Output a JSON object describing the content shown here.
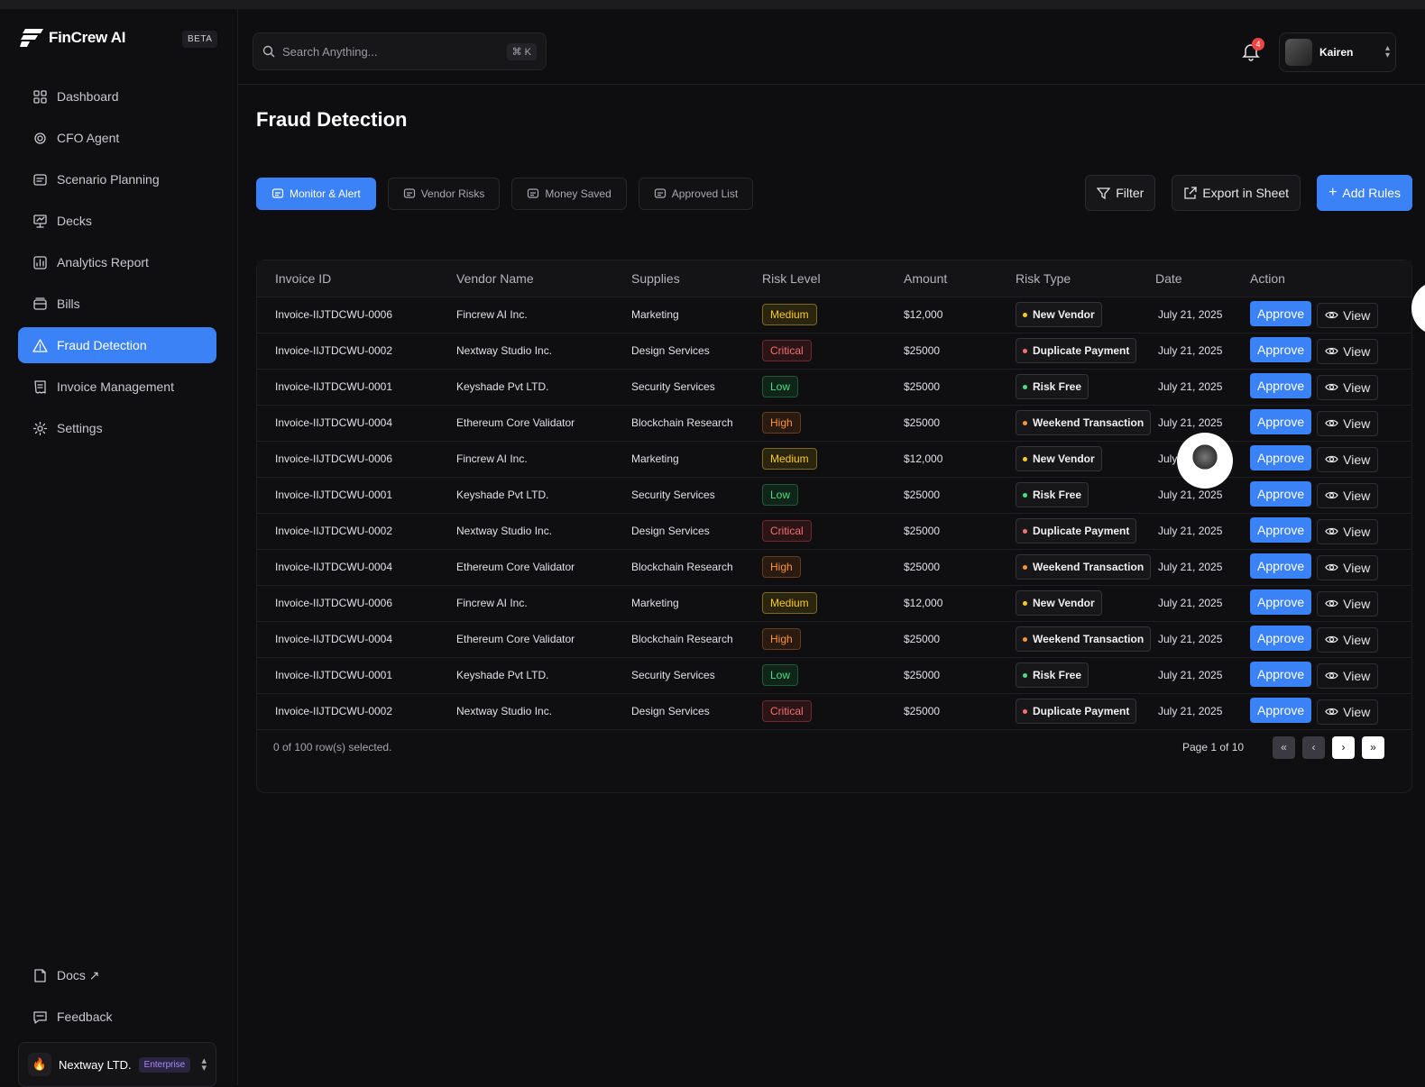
{
  "app": {
    "brand": "FinCrew AI",
    "badge": "BETA"
  },
  "sidebar": {
    "items": [
      {
        "label": "Dashboard",
        "icon": "grid-icon"
      },
      {
        "label": "CFO Agent",
        "icon": "agent-icon"
      },
      {
        "label": "Scenario Planning",
        "icon": "planning-icon"
      },
      {
        "label": "Decks",
        "icon": "presentation-icon"
      },
      {
        "label": "Analytics Report",
        "icon": "chart-icon"
      },
      {
        "label": "Bills",
        "icon": "wallet-icon"
      },
      {
        "label": "Fraud Detection",
        "icon": "alert-triangle-icon",
        "active": true
      },
      {
        "label": "Invoice Management",
        "icon": "receipt-icon"
      },
      {
        "label": "Settings",
        "icon": "gear-icon"
      }
    ],
    "bottom": [
      {
        "label": "Docs ↗",
        "icon": "docs-icon"
      },
      {
        "label": "Feedback",
        "icon": "feedback-icon"
      }
    ],
    "org": {
      "name": "Nextway LTD.",
      "plan": "Enterprise"
    }
  },
  "header": {
    "search_placeholder": "Search Anything...",
    "shortcut": "⌘ K",
    "notifications": "4",
    "user": "Kairen"
  },
  "page": {
    "title": "Fraud Detection",
    "tabs": [
      {
        "label": "Monitor & Alert",
        "active": true
      },
      {
        "label": "Vendor Risks"
      },
      {
        "label": "Money Saved"
      },
      {
        "label": "Approved List"
      }
    ],
    "actions": {
      "filter": "Filter",
      "export": "Export in Sheet",
      "add": "Add Rules"
    }
  },
  "table": {
    "columns": [
      "Invoice ID",
      "Vendor Name",
      "Supplies",
      "Risk Level",
      "Amount",
      "Risk Type",
      "Date",
      "Action"
    ],
    "rows": [
      [
        "Invoice-IIJTDCWU-0006",
        "Fincrew AI Inc.",
        "Marketing",
        "Medium",
        "$12,000",
        "New Vendor",
        "July 21, 2025"
      ],
      [
        "Invoice-IIJTDCWU-0002",
        "Nextway Studio Inc.",
        "Design Services",
        "Critical",
        "$25000",
        "Duplicate Payment",
        "July 21, 2025"
      ],
      [
        "Invoice-IIJTDCWU-0001",
        "Keyshade Pvt LTD.",
        "Security Services",
        "Low",
        "$25000",
        "Risk Free",
        "July 21, 2025"
      ],
      [
        "Invoice-IIJTDCWU-0004",
        "Ethereum Core Validator",
        "Blockchain Research",
        "High",
        "$25000",
        "Weekend Transaction",
        "July 21, 2025"
      ],
      [
        "Invoice-IIJTDCWU-0006",
        "Fincrew AI Inc.",
        "Marketing",
        "Medium",
        "$12,000",
        "New Vendor",
        "July 21, 2025"
      ],
      [
        "Invoice-IIJTDCWU-0001",
        "Keyshade Pvt LTD.",
        "Security Services",
        "Low",
        "$25000",
        "Risk Free",
        "July 21, 2025"
      ],
      [
        "Invoice-IIJTDCWU-0002",
        "Nextway Studio Inc.",
        "Design Services",
        "Critical",
        "$25000",
        "Duplicate Payment",
        "July 21, 2025"
      ],
      [
        "Invoice-IIJTDCWU-0004",
        "Ethereum Core Validator",
        "Blockchain Research",
        "High",
        "$25000",
        "Weekend Transaction",
        "July 21, 2025"
      ],
      [
        "Invoice-IIJTDCWU-0006",
        "Fincrew AI Inc.",
        "Marketing",
        "Medium",
        "$12,000",
        "New Vendor",
        "July 21, 2025"
      ],
      [
        "Invoice-IIJTDCWU-0004",
        "Ethereum Core Validator",
        "Blockchain Research",
        "High",
        "$25000",
        "Weekend Transaction",
        "July 21, 2025"
      ],
      [
        "Invoice-IIJTDCWU-0001",
        "Keyshade Pvt LTD.",
        "Security Services",
        "Low",
        "$25000",
        "Risk Free",
        "July 21, 2025"
      ],
      [
        "Invoice-IIJTDCWU-0002",
        "Nextway Studio Inc.",
        "Design Services",
        "Critical",
        "$25000",
        "Duplicate Payment",
        "July 21, 2025"
      ]
    ],
    "approve_label": "Approve",
    "view_label": "View",
    "selection": "0 of 100 row(s) selected.",
    "page": "Page 1 of 10",
    "pager": {
      "first": "«",
      "prev": "‹",
      "next": "›",
      "last": "»"
    }
  },
  "colors": {
    "accent": "#3b82f6",
    "medium": "#facc15",
    "critical": "#f87171",
    "low": "#4ade80",
    "high": "#fb923c"
  }
}
